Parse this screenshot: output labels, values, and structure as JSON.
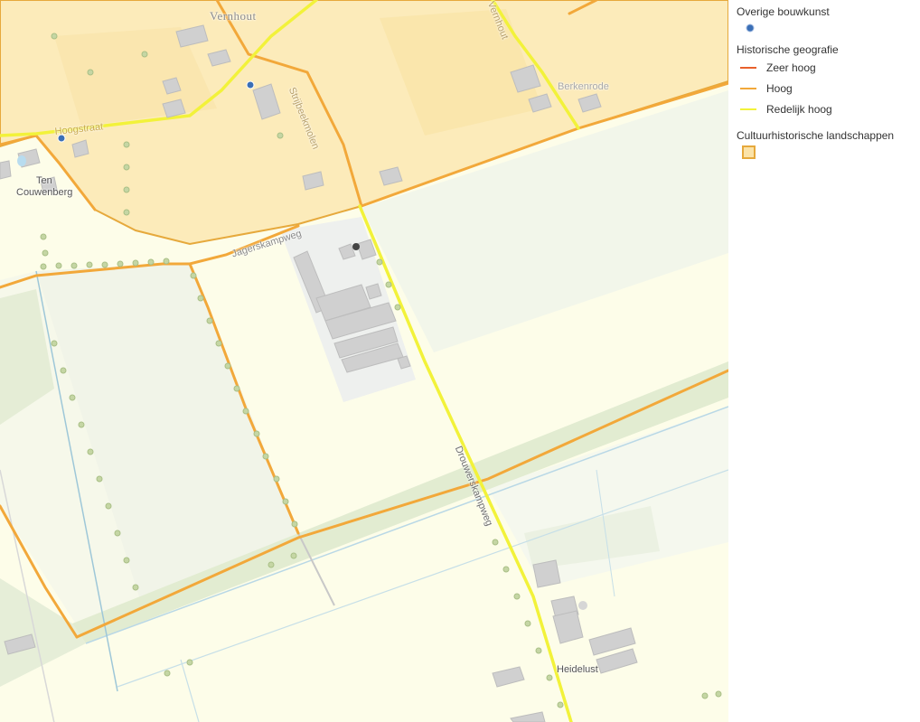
{
  "map": {
    "labels": {
      "vernhout": "Vernhout",
      "hoogstraat": "Hoogstraat",
      "ten": "Ten",
      "couwenberg": "Couwenberg",
      "berkenrode": "Berkenrode",
      "jagerskampweg": "Jagerskampweg",
      "strijbeekmolen": "Strijbeekmolen",
      "drouwerskampweg": "Drouwerskampweg",
      "heidelust": "Heidelust",
      "top_road": "Vernhout"
    }
  },
  "legend": {
    "overige_title": "Overige bouwkunst",
    "overige_symbol_color": "#3b6fb6",
    "hist_geo_title": "Historische geografie",
    "hist_geo_items": [
      {
        "label": "Zeer hoog",
        "color": "#e8602c"
      },
      {
        "label": "Hoog",
        "color": "#f2a83a"
      },
      {
        "label": "Redelijk hoog",
        "color": "#f2f23a"
      }
    ],
    "landscapes_title": "Cultuurhistorische landschappen",
    "landscapes_fill": "#fbe3a8",
    "landscapes_stroke": "#e6a93c"
  }
}
